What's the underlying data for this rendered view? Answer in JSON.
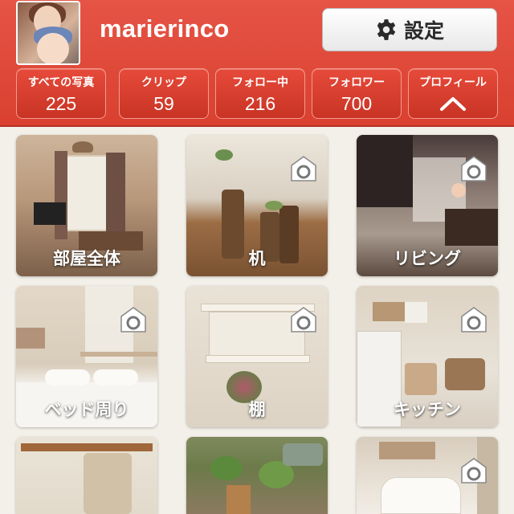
{
  "profile": {
    "username": "marierinco"
  },
  "settings": {
    "label": "設定"
  },
  "stats": [
    {
      "label": "すべての写真",
      "value": "225"
    },
    {
      "label": "クリップ",
      "value": "59"
    },
    {
      "label": "フォロー中",
      "value": "216"
    },
    {
      "label": "フォロワー",
      "value": "700"
    },
    {
      "label": "プロフィール",
      "value": ""
    }
  ],
  "tiles": [
    {
      "caption": "部屋全体"
    },
    {
      "caption": "机"
    },
    {
      "caption": "リビング"
    },
    {
      "caption": "ベッド周り"
    },
    {
      "caption": "棚"
    },
    {
      "caption": "キッチン"
    },
    {
      "caption": ""
    },
    {
      "caption": ""
    },
    {
      "caption": ""
    }
  ],
  "colors": {
    "header": "#e04a3b",
    "background": "#f3efe9"
  }
}
